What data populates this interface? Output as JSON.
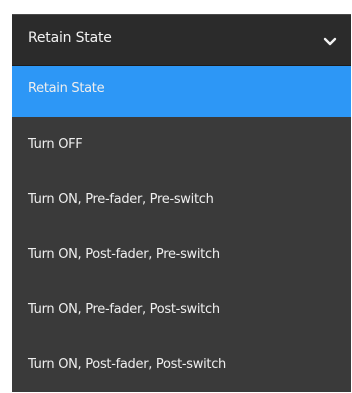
{
  "select": {
    "value": "Retain State",
    "icon": "chevron-down-icon"
  },
  "options": [
    {
      "label": "Retain State",
      "selected": true
    },
    {
      "label": "Turn OFF",
      "selected": false
    },
    {
      "label": "Turn ON, Pre-fader, Pre-switch",
      "selected": false
    },
    {
      "label": "Turn ON, Post-fader, Pre-switch",
      "selected": false
    },
    {
      "label": "Turn ON, Pre-fader, Post-switch",
      "selected": false
    },
    {
      "label": "Turn ON, Post-fader, Post-switch",
      "selected": false
    }
  ],
  "colors": {
    "header_bg": "#2b2b2b",
    "menu_bg": "#3a3a3a",
    "selected_bg": "#2d97f6",
    "text": "#eeeeee"
  }
}
